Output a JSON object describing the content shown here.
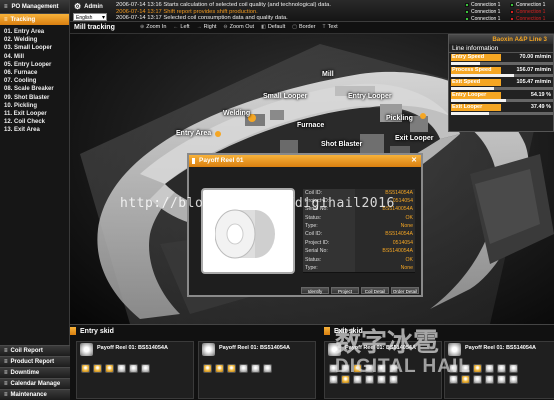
{
  "sidebar": {
    "header": "PO Management",
    "active_tab": "Tracking",
    "items": [
      "01. Entry Area",
      "02. Welding",
      "03. Small Looper",
      "04. Mill",
      "05. Entry Looper",
      "06. Furnace",
      "07. Cooling",
      "08. Scale Breaker",
      "09. Shot Blaster",
      "10. Pickling",
      "11. Exit Looper",
      "12. Coil Check",
      "13. Exit Area"
    ],
    "bottom": [
      "Coil Report",
      "Product Report",
      "Downtime",
      "Calendar Manage",
      "Maintenance"
    ]
  },
  "topbar": {
    "user": "Admin",
    "language": "English",
    "messages": [
      "2006-07-14 13:16 Starts calculation of selected coil quality (and technological) data.",
      "2006-07-14 13:17 Shift report provides shift production.",
      "2006-07-14 13:17 Selected coil consumption data and quality data."
    ],
    "connections": [
      {
        "label": "Connection 1",
        "status": "ok",
        "color": "#3ac23a"
      },
      {
        "label": "Connection 1",
        "status": "ok",
        "color": "#3ac23a"
      },
      {
        "label": "Connection 1",
        "status": "ok",
        "color": "#3ac23a"
      },
      {
        "label": "Connection 1",
        "status": "error",
        "color": "#d82020"
      },
      {
        "label": "Connection 1",
        "status": "ok",
        "color": "#3ac23a"
      },
      {
        "label": "Connection 1",
        "status": "error",
        "color": "#d82020"
      },
      {
        "label": "Connection 1",
        "status": "ok",
        "color": "#3ac23a"
      },
      {
        "label": "Connection 1",
        "status": "error",
        "color": "#d82020"
      }
    ]
  },
  "tracking": {
    "title": "Mill tracking",
    "tools": [
      "Zoom In",
      "Left",
      "Right",
      "Zoom Out",
      "Default",
      "Border",
      "Text"
    ]
  },
  "scene_labels": {
    "mill": "Mill",
    "small_looper": "Small Looper",
    "entry_looper": "Entry Looper",
    "welding": "Welding",
    "entry_area": "Entry Area",
    "furnace": "Furnace",
    "pickling": "Pickling",
    "exit_looper": "Exit Looper",
    "shot_blaster": "Shot Blaster"
  },
  "info_panel": {
    "title": "Baoxin A&P Line 3",
    "subtitle": "Line information",
    "rows": [
      {
        "name": "Entry Speed",
        "value": "70.00 m/min",
        "fill": 0.28
      },
      {
        "name": "Process Speed",
        "value": "156.07 m/min",
        "fill": 0.62
      },
      {
        "name": "Exit Speed",
        "value": "105.47 m/min",
        "fill": 0.42
      },
      {
        "name": "Entry Looper",
        "value": "54.19 %",
        "fill": 0.54
      },
      {
        "name": "Exit Looper",
        "value": "37.49 %",
        "fill": 0.37
      }
    ]
  },
  "popup": {
    "title": "Payoff Reel 01",
    "fields": [
      {
        "k": "Coil ID:",
        "v": "BS514054A"
      },
      {
        "k": "Project ID:",
        "v": "0514054"
      },
      {
        "k": "Serial No:",
        "v": "BS5140054A"
      },
      {
        "k": "Status:",
        "v": "OK"
      },
      {
        "k": "Type:",
        "v": "None"
      },
      {
        "k": "Coil ID:",
        "v": "BS514054A"
      },
      {
        "k": "Project ID:",
        "v": "0514054"
      },
      {
        "k": "Serial No:",
        "v": "BS5140054A"
      },
      {
        "k": "Status:",
        "v": "OK"
      },
      {
        "k": "Type:",
        "v": "None"
      }
    ],
    "buttons": [
      "Identify",
      "Project",
      "Coil Detail",
      "Order Detail"
    ]
  },
  "entry_skid": {
    "title": "Entry skid",
    "cards": [
      {
        "title": "Payoff Reel 01: BS514054A"
      },
      {
        "title": "Payoff Reel 01: BS514054A"
      }
    ]
  },
  "exit_skid": {
    "title": "Exit skid",
    "cards": [
      {
        "title": "Payoff Reel 01: BS514054A"
      },
      {
        "title": "Payoff Reel 01: BS514054A"
      }
    ]
  },
  "watermark": {
    "url": "http://blog.csdn.net/digihail2016",
    "cn": "数字冰雹",
    "en": "DIGITAL HAIL"
  }
}
